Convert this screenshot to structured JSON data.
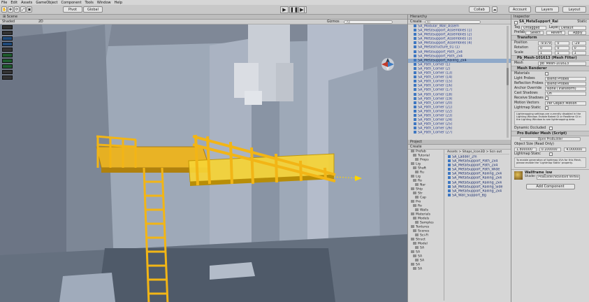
{
  "menu": [
    "File",
    "Edit",
    "Assets",
    "GameObject",
    "Component",
    "Tools",
    "Window",
    "Help"
  ],
  "toolbar": {
    "pivot": "Pivot",
    "global": "Global",
    "collab": "Collab",
    "account": "Account",
    "layers": "Layers",
    "layout": "Layout"
  },
  "scene": {
    "mode": "Shaded",
    "dim": "2D",
    "gizmos": "Gizmos",
    "search_placeholder": "All",
    "tool_icons": [
      "hand-icon",
      "move-icon",
      "rotate-icon",
      "scale-icon",
      "rect-icon",
      "probuilder-icon",
      "face-icon",
      "edge-icon",
      "vertex-icon",
      "object-icon"
    ]
  },
  "hierarchy": {
    "tab": "Hierarchy",
    "create": "Create",
    "search": "All",
    "items": [
      "SA_Modular_Wall_Assem",
      "SA_MetaSupport_Assemblies (1)",
      "SA_MetaSupport_Assemblies (2)",
      "SA_MetaSupport_Assemblies (3)",
      "SA_MetaSupport_Assemblies (4)",
      "SA_MetaStructure_01 (1)",
      "SA_MetaSupport_Path_2x4",
      "SA_MetaSupport_Path_2x4",
      "SA_MetaSupport_Railing_2x4",
      "SA_Path_Corner (1)",
      "SA_Path_Corner (2)",
      "SA_Path_Corner (13)",
      "SA_Path_Corner (14)",
      "SA_Path_Corner (15)",
      "SA_Path_Corner (16)",
      "SA_Path_Corner (17)",
      "SA_Path_Corner (18)",
      "SA_Path_Corner (19)",
      "SA_Path_Corner (20)",
      "SA_Path_Corner (21)",
      "SA_Path_Corner (22)",
      "SA_Path_Corner (23)",
      "SA_Path_Corner (24)",
      "SA_Path_Corner (25)",
      "SA_Path_Corner (26)",
      "SA_Path_Corner (27)"
    ],
    "selected_index": 8
  },
  "project": {
    "tab": "Project",
    "create": "Create",
    "breadcrumb": "Assets > Shaps_Icon3D > Scn out",
    "tree": [
      "Prefab",
      "Tutorial",
      "Props",
      "Lig",
      "Shaft",
      "Ru",
      "Lig",
      "Ro",
      "Nar",
      "Ship",
      "Str",
      "Cap",
      "Pro",
      "Ro",
      "Walls",
      "Materials",
      "Models",
      "Samples",
      "Textures",
      "Scenes",
      "Sci-Fi",
      "Struct",
      "Model",
      "SA",
      "SA",
      "SA",
      "SA",
      "SA",
      "SA"
    ],
    "files": [
      "SA_Ladder_2m",
      "SA_MetalSupport_Path_2x4",
      "SA_MetalSupport_Path_2x4",
      "SA_MetalSupport_Path_Wide",
      "SA_MetalSupport_Railing_2x4",
      "SA_MetalSupport_Railing_2x4",
      "SA_MetalSupport_Railing_2x4",
      "SA_MetalSupport_Railing_Side",
      "SA_MetalSupport_Railing_2x4",
      "SA_Wall_Support_Bg"
    ]
  },
  "inspector": {
    "tab": "Inspector",
    "name": "SA_MetaSupport_Rai",
    "static": "Static",
    "tag_label": "Tag",
    "tag": "Untagged",
    "layer_label": "Layer",
    "layer": "Default",
    "prefab_label": "Prefab",
    "prefab_select": "Select",
    "prefab_revert": "Revert",
    "prefab_apply": "Apply",
    "transform": {
      "title": "Transform",
      "position_label": "Position",
      "rotation_label": "Rotation",
      "scale_label": "Scale",
      "pos": [
        "-9.979",
        "0",
        "-29"
      ],
      "rot": [
        "0",
        "0",
        "0"
      ],
      "scl": [
        "1",
        "1",
        "1"
      ]
    },
    "mesh_filter": {
      "title": "Pb_Mesh-101613 (Mesh Filter)",
      "mesh_label": "Mesh",
      "mesh": "pb_Mesh-101613"
    },
    "mesh_renderer": {
      "title": "Mesh Renderer",
      "rows": [
        [
          "Materials",
          ""
        ],
        [
          "Light Probes",
          "Blend Probes"
        ],
        [
          "Reflection Probes",
          "Blend Probes"
        ],
        [
          "Anchor Override",
          "None (Transform)"
        ],
        [
          "Cast Shadows",
          "On"
        ],
        [
          "Receive Shadows",
          ""
        ],
        [
          "Motion Vectors",
          "Per Object Motion"
        ],
        [
          "Lightmap Static",
          ""
        ]
      ],
      "note": "Lightmapping settings are currently disabled in the Lighting Window. Enable Baked GI or Realtime GI in the Lighting Window to see lightmapping data.",
      "dynamic_occluded": "Dynamic Occluded"
    },
    "pb_mesh": {
      "title": "Pro Builder Mesh (Script)",
      "open": "Open ProBuilder",
      "uv_label": "Object Size (Read Only)",
      "uv": [
        "1.800000",
        "0.100000",
        "4.000000"
      ],
      "lightmap": "Lightmap Static",
      "warning": "To enable generation of lightmap UVs for this Mesh, please enable the 'Lightmap Static' property."
    },
    "material": {
      "name": "Wallframe_low",
      "shader_label": "Shader",
      "shader": "ProBuilder/Standard Vertex Color"
    },
    "add_component": "Add Component"
  },
  "colors": {
    "ladder": "#f2b516",
    "panel": "#d6d6d6",
    "selected_row": "#8fa9c9",
    "viewport_bg": "#9aa6b6"
  }
}
